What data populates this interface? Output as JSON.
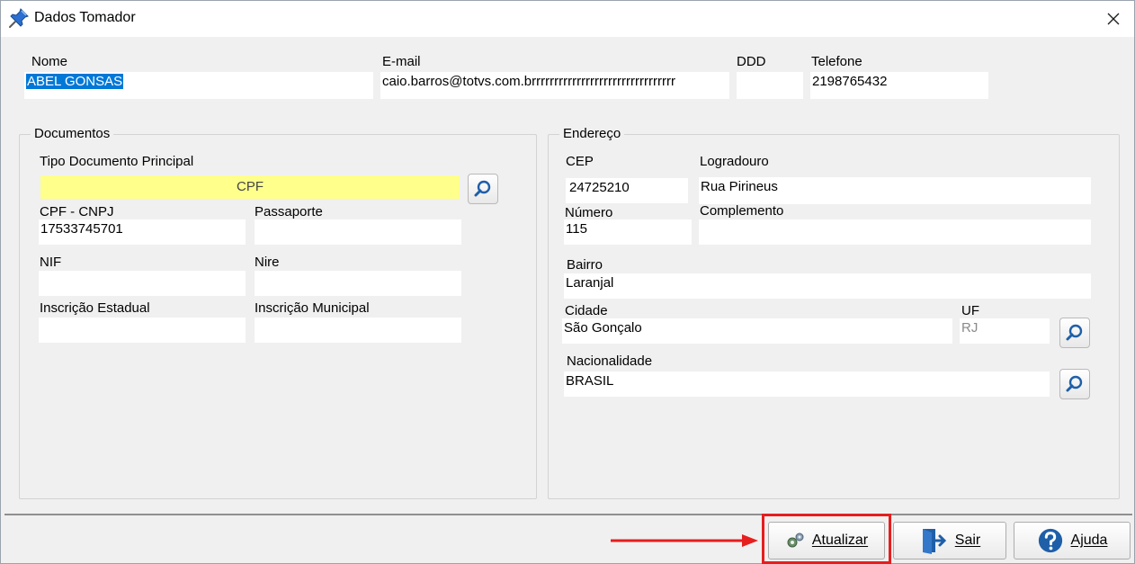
{
  "window": {
    "title": "Dados Tomador"
  },
  "top": {
    "nome_label": "Nome",
    "nome_value": "ABEL GONSAS",
    "email_label": "E-mail",
    "email_value": "caio.barros@totvs.com.brrrrrrrrrrrrrrrrrrrrrrrrrrrrrrrr",
    "ddd_label": "DDD",
    "ddd_value": "",
    "telefone_label": "Telefone",
    "telefone_value": "2198765432"
  },
  "documentos": {
    "title": "Documentos",
    "tipo_label": "Tipo Documento Principal",
    "tipo_value": "CPF",
    "cpf_label": "CPF - CNPJ",
    "cpf_value": "17533745701",
    "passaporte_label": "Passaporte",
    "passaporte_value": "",
    "nif_label": "NIF",
    "nif_value": "",
    "nire_label": "Nire",
    "nire_value": "",
    "ie_label": "Inscrição Estadual",
    "ie_value": "",
    "im_label": "Inscrição Municipal",
    "im_value": ""
  },
  "endereco": {
    "title": "Endereço",
    "cep_label": "CEP",
    "cep_value": "24725210",
    "logradouro_label": "Logradouro",
    "logradouro_value": "Rua Pirineus",
    "numero_label": "Número",
    "numero_value": "115",
    "complemento_label": "Complemento",
    "complemento_value": "",
    "bairro_label": "Bairro",
    "bairro_value": "Laranjal",
    "cidade_label": "Cidade",
    "cidade_value": "São Gonçalo",
    "uf_label": "UF",
    "uf_value": "RJ",
    "nacionalidade_label": "Nacionalidade",
    "nacionalidade_value": "BRASIL"
  },
  "footer": {
    "atualizar_label": "Atualizar",
    "sair_label": "Sair",
    "ajuda_label": "Ajuda"
  },
  "colors": {
    "highlight": "#e61e1e",
    "selection": "#0078d7",
    "required_field": "#ffff8c",
    "icon_blue": "#1e5fa8"
  },
  "icons": {
    "title": "pushpin-icon",
    "close": "close-icon",
    "search": "magnifier-icon",
    "atualizar": "gears-icon",
    "sair": "exit-door-icon",
    "ajuda": "help-icon"
  }
}
